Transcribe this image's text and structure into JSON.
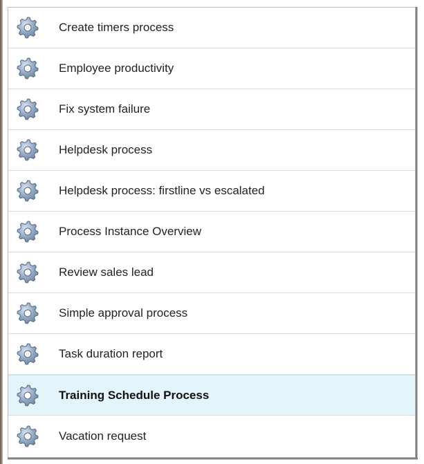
{
  "process_list": {
    "items": [
      {
        "label": "Create timers process",
        "icon": "gear-icon",
        "selected": false
      },
      {
        "label": "Employee productivity",
        "icon": "gear-icon",
        "selected": false
      },
      {
        "label": "Fix system failure",
        "icon": "gear-icon",
        "selected": false
      },
      {
        "label": "Helpdesk process",
        "icon": "gear-icon",
        "selected": false
      },
      {
        "label": "Helpdesk process: firstline vs escalated",
        "icon": "gear-icon",
        "selected": false
      },
      {
        "label": "Process Instance Overview",
        "icon": "gear-icon",
        "selected": false
      },
      {
        "label": "Review sales lead",
        "icon": "gear-icon",
        "selected": false
      },
      {
        "label": "Simple approval process",
        "icon": "gear-icon",
        "selected": false
      },
      {
        "label": "Task duration report",
        "icon": "gear-icon",
        "selected": false
      },
      {
        "label": "Training Schedule Process",
        "icon": "gear-icon",
        "selected": true
      },
      {
        "label": "Vacation request",
        "icon": "gear-icon",
        "selected": false
      }
    ]
  },
  "colors": {
    "selected_row_bg": "#e4f4fb",
    "row_divider": "#d9d9d9",
    "gear_fill": "#8fa3bd",
    "gear_stroke": "#4d6585"
  }
}
